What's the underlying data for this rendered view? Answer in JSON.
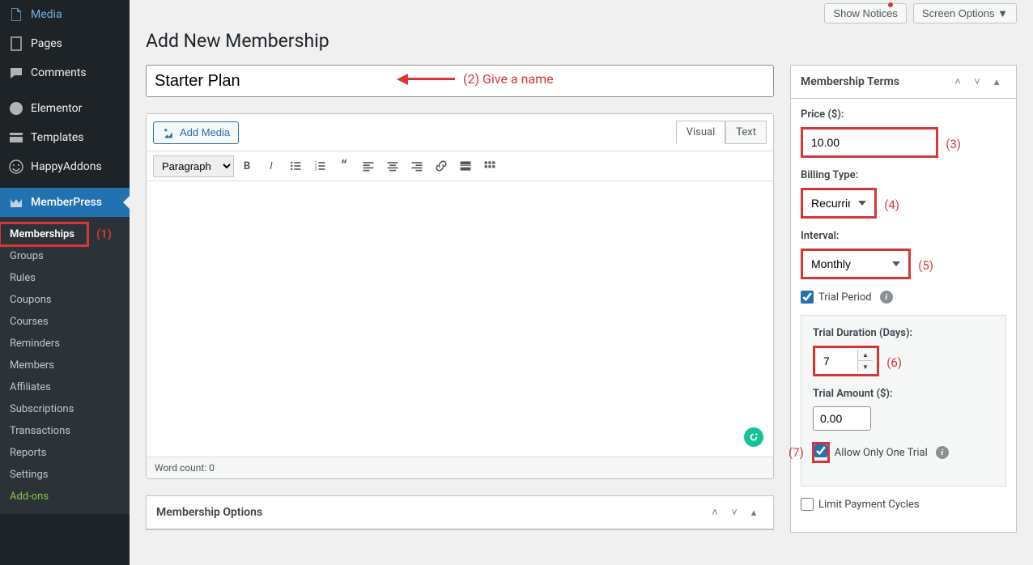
{
  "sidebar": {
    "items": [
      {
        "label": "Media",
        "icon": "media-icon"
      },
      {
        "label": "Pages",
        "icon": "page-icon"
      },
      {
        "label": "Comments",
        "icon": "comment-icon"
      },
      {
        "label": "Elementor",
        "icon": "elementor-icon"
      },
      {
        "label": "Templates",
        "icon": "templates-icon"
      },
      {
        "label": "HappyAddons",
        "icon": "happy-icon"
      },
      {
        "label": "MemberPress",
        "icon": "memberpress-icon"
      }
    ],
    "submenu": [
      {
        "label": "Memberships"
      },
      {
        "label": "Groups"
      },
      {
        "label": "Rules"
      },
      {
        "label": "Coupons"
      },
      {
        "label": "Courses"
      },
      {
        "label": "Reminders"
      },
      {
        "label": "Members"
      },
      {
        "label": "Affiliates"
      },
      {
        "label": "Subscriptions"
      },
      {
        "label": "Transactions"
      },
      {
        "label": "Reports"
      },
      {
        "label": "Settings"
      },
      {
        "label": "Add-ons"
      }
    ]
  },
  "top": {
    "show_notices": "Show Notices",
    "screen_options": "Screen Options ▼"
  },
  "page": {
    "title": "Add New Membership",
    "title_input": "Starter Plan",
    "add_media": "Add Media",
    "tab_visual": "Visual",
    "tab_text": "Text",
    "format_sel": "Paragraph",
    "word_count": "Word count: 0"
  },
  "options_box": {
    "title": "Membership Options"
  },
  "terms": {
    "title": "Membership Terms",
    "price_label": "Price ($):",
    "price_value": "10.00",
    "billing_label": "Billing Type:",
    "billing_value": "Recurring",
    "interval_label": "Interval:",
    "interval_value": "Monthly",
    "trial_period": "Trial Period",
    "trial_duration_label": "Trial Duration (Days):",
    "trial_duration_value": "7",
    "trial_amount_label": "Trial Amount ($):",
    "trial_amount_value": "0.00",
    "allow_one_trial": "Allow Only One Trial",
    "limit_cycles": "Limit Payment Cycles"
  },
  "annotations": {
    "a1": "(1)",
    "a2": "(2) Give a name",
    "a3": "(3)",
    "a4": "(4)",
    "a5": "(5)",
    "a6": "(6)",
    "a7": "(7)"
  }
}
